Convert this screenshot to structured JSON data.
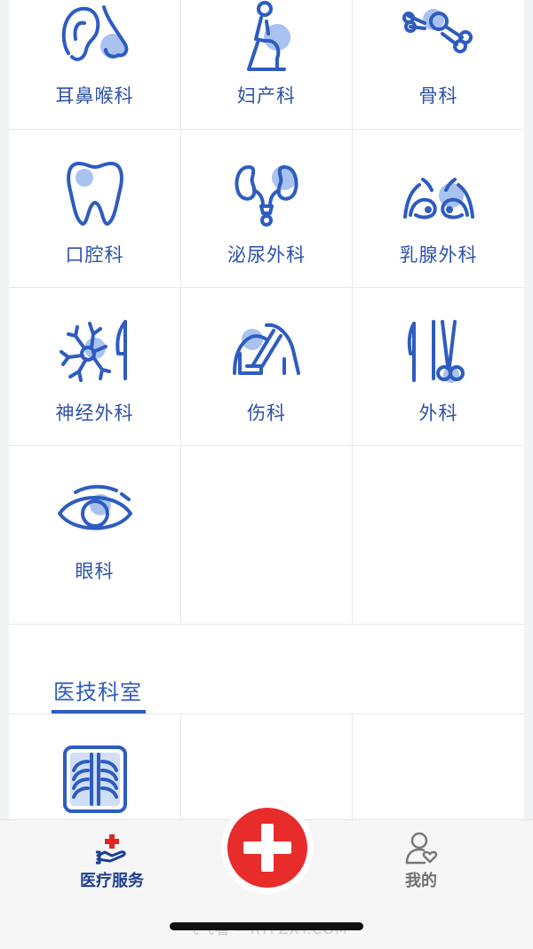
{
  "departments": [
    {
      "label": "耳鼻喉科",
      "icon": "ear-nose-icon"
    },
    {
      "label": "妇产科",
      "icon": "pregnant-woman-icon"
    },
    {
      "label": "骨科",
      "icon": "bone-joint-icon"
    },
    {
      "label": "口腔科",
      "icon": "tooth-icon"
    },
    {
      "label": "泌尿外科",
      "icon": "kidney-icon"
    },
    {
      "label": "乳腺外科",
      "icon": "breast-icon"
    },
    {
      "label": "神经外科",
      "icon": "neuron-scalpel-icon"
    },
    {
      "label": "伤科",
      "icon": "arm-sling-icon"
    },
    {
      "label": "外科",
      "icon": "scalpel-scissors-icon"
    },
    {
      "label": "眼科",
      "icon": "eye-icon"
    }
  ],
  "section": {
    "title": "医技科室"
  },
  "tech_departments": [
    {
      "label": "",
      "icon": "xray-icon"
    }
  ],
  "tabbar": {
    "medical": {
      "label": "医疗服务",
      "icon": "medical-service-icon"
    },
    "center": {
      "icon": "red-cross-icon"
    },
    "mine": {
      "label": "我的",
      "icon": "user-heart-icon"
    }
  },
  "watermark": "飞飞看 • RYFZXY.COM",
  "colors": {
    "accent": "#2e5cc0",
    "icon_blue": "#2e5cc0",
    "icon_fill": "#a9c2ef",
    "red": "#e82b2b"
  }
}
